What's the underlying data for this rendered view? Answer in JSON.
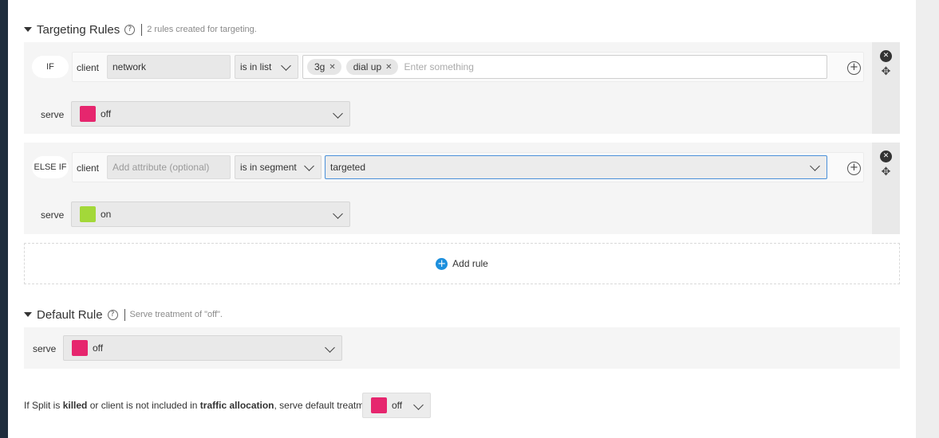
{
  "targeting": {
    "title": "Targeting Rules",
    "help": "?",
    "subtitle": "2 rules created for targeting."
  },
  "rules": [
    {
      "keyword": "IF",
      "client_label": "client",
      "attribute_value": "network",
      "attribute_placeholder": "",
      "operator": "is in list",
      "tags": [
        "3g",
        "dial up"
      ],
      "tag_placeholder": "Enter something",
      "serve_label": "serve",
      "treatment": "off",
      "treatment_color": "#e6266e"
    },
    {
      "keyword": "ELSE IF",
      "client_label": "client",
      "attribute_value": "",
      "attribute_placeholder": "Add attribute (optional)",
      "operator": "is in segment",
      "segment": "targeted",
      "serve_label": "serve",
      "treatment": "on",
      "treatment_color": "#a3d839"
    }
  ],
  "add_rule": {
    "label": "Add rule"
  },
  "default_rule": {
    "title": "Default Rule",
    "help": "?",
    "subtitle": "Serve treatment of \"off\".",
    "serve_label": "serve",
    "treatment": "off",
    "treatment_color": "#e6266e"
  },
  "kill": {
    "part1": "If Split is ",
    "bold1": "killed",
    "part2": " or client is not included in ",
    "bold2": "traffic allocation",
    "part3": ", serve default treatment",
    "treatment": "off",
    "treatment_color": "#e6266e"
  },
  "icons": {
    "plus": "+",
    "close": "✕",
    "move": "✥",
    "chip_remove": "✕"
  },
  "colors": {
    "accent": "#1c8fdd",
    "off": "#e6266e",
    "on": "#a3d839"
  }
}
